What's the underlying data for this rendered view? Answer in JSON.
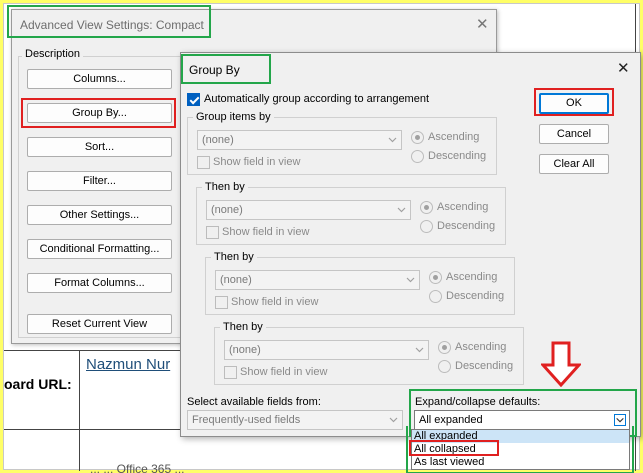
{
  "background": {
    "link_text": "Nazmun Nur",
    "label_text": "oard URL:",
    "bottom_text": "... ... Office 365 ..."
  },
  "dialog1": {
    "title": "Advanced View Settings: Compact",
    "group_label": "Description",
    "buttons": {
      "columns": "Columns...",
      "group_by": "Group By...",
      "sort": "Sort...",
      "filter": "Filter...",
      "other_settings": "Other Settings...",
      "conditional_formatting": "Conditional Formatting...",
      "format_columns": "Format Columns...",
      "reset": "Reset Current View"
    }
  },
  "dialog2": {
    "title": "Group By",
    "auto_group_label": "Automatically group according to arrangement",
    "auto_group_checked": true,
    "ok": "OK",
    "cancel": "Cancel",
    "clear_all": "Clear All",
    "groups": [
      {
        "legend": "Group items by",
        "value": "(none)",
        "show_field": "Show field in view",
        "ascending": "Ascending",
        "descending": "Descending"
      },
      {
        "legend": "Then by",
        "value": "(none)",
        "show_field": "Show field in view",
        "ascending": "Ascending",
        "descending": "Descending"
      },
      {
        "legend": "Then by",
        "value": "(none)",
        "show_field": "Show field in view",
        "ascending": "Ascending",
        "descending": "Descending"
      },
      {
        "legend": "Then by",
        "value": "(none)",
        "show_field": "Show field in view",
        "ascending": "Ascending",
        "descending": "Descending"
      }
    ],
    "fields_from_label": "Select available fields from:",
    "fields_from_value": "Frequently-used fields",
    "expand_label": "Expand/collapse defaults:",
    "expand_value": "All expanded",
    "expand_options": [
      "All expanded",
      "All collapsed",
      "As last viewed"
    ]
  },
  "colors": {
    "highlight_green": "#23a64a",
    "highlight_red": "#e02020",
    "page_border": "#ffff66"
  }
}
